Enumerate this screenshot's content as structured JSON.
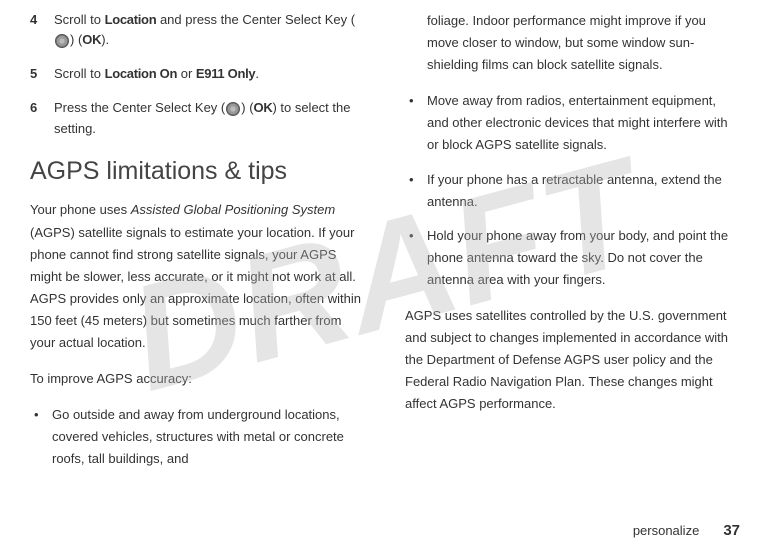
{
  "watermark": "DRAFT",
  "steps": [
    {
      "num": "4",
      "prefix": "Scroll to ",
      "bold1": "Location",
      "mid1": " and press the Center Select Key (",
      "icon": true,
      "mid2": ") (",
      "bold2": "OK",
      "suffix": ")."
    },
    {
      "num": "5",
      "prefix": "Scroll to ",
      "bold1": "Location On",
      "mid1": " or ",
      "bold2": "E911 Only",
      "suffix": "."
    },
    {
      "num": "6",
      "prefix": "Press the Center Select Key (",
      "icon": true,
      "mid1": ") (",
      "bold1": "OK",
      "suffix": ") to select the setting."
    }
  ],
  "heading": "AGPS limitations & tips",
  "intro_pre": "Your phone uses ",
  "intro_italic": "Assisted Global Positioning System",
  "intro_post": " (AGPS) satellite signals to estimate your location. If your phone cannot find strong satellite signals, your AGPS might be slower, less accurate, or it might not work at all. AGPS provides only an approximate location, often within 150 feet (45 meters) but sometimes much farther from your actual location.",
  "improve": "To improve AGPS accuracy:",
  "bullets_left": [
    "Go outside and away from underground locations, covered vehicles, structures with metal or concrete roofs, tall buildings, and"
  ],
  "col2_continuation": "foliage. Indoor performance might improve if you move closer to window, but some window sun-shielding films can block satellite signals.",
  "bullets_right": [
    "Move away from radios, entertainment equipment, and other electronic devices that might interfere with or block AGPS satellite signals.",
    "If your phone has a retractable antenna, extend the antenna.",
    "Hold your phone away from your body, and point the phone antenna toward the sky. Do not cover the antenna area with your fingers."
  ],
  "closing": "AGPS uses satellites controlled by the U.S. government and subject to changes implemented in accordance with the Department of Defense AGPS user policy and the Federal Radio Navigation Plan. These changes might affect AGPS performance.",
  "footer_label": "personalize",
  "footer_page": "37"
}
